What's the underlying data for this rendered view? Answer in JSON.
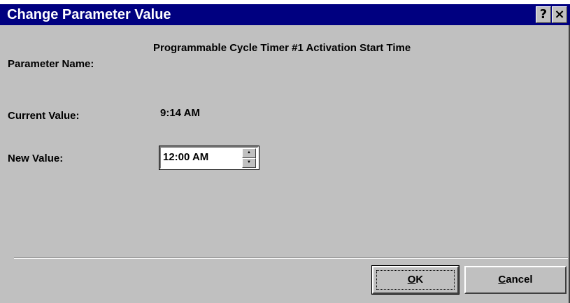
{
  "window": {
    "title": "Change Parameter Value",
    "help_glyph": "?",
    "close_glyph": "×"
  },
  "fields": {
    "parameter_name_label": "Parameter Name:",
    "parameter_name_value": "Programmable Cycle Timer #1 Activation Start Time",
    "current_value_label": "Current Value:",
    "current_value": "9:14 AM",
    "new_value_label": "New Value:",
    "new_value": "12:00 AM"
  },
  "buttons": {
    "ok_accel": "O",
    "ok_rest": "K",
    "cancel_accel": "C",
    "cancel_rest": "ancel"
  },
  "icons": {
    "spin_up": "spin-up-arrow-icon",
    "spin_down": "spin-down-arrow-icon"
  },
  "colors": {
    "titlebar": "#000080",
    "dialog_face": "#c0c0c0"
  }
}
